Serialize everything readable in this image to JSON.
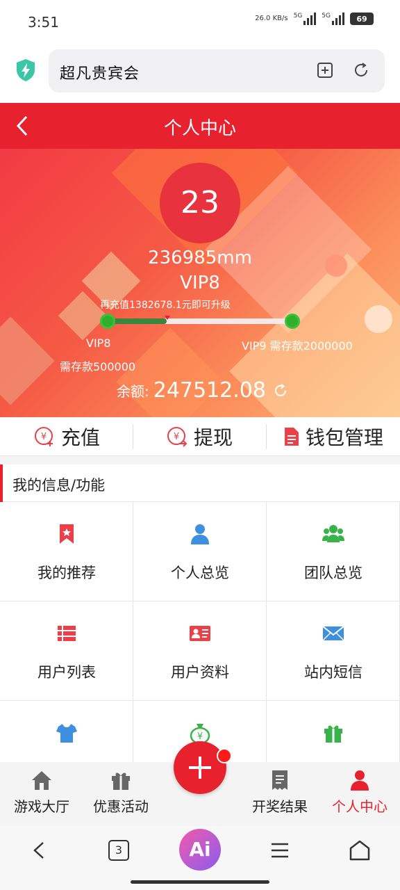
{
  "status": {
    "time": "3:51",
    "net_speed": "26.0 KB/s",
    "net1": "5G",
    "net2": "5G",
    "battery": "69"
  },
  "browser": {
    "url_title": "超凡贵宾会",
    "shield_icon": "shield-bolt-icon",
    "add_tab_icon": "add-tab-icon",
    "refresh_icon": "refresh-icon"
  },
  "header": {
    "title": "个人中心",
    "back_icon": "chevron-left-icon"
  },
  "profile": {
    "level_number": "23",
    "username": "236985mm",
    "vip": "VIP8",
    "upgrade_note": "再充值1382678.1元即可升级",
    "progress_fraction": 0.32,
    "current_level": "VIP8",
    "current_requirement": "需存款500000",
    "next_level": "VIP9 需存款2000000",
    "balance_label": "余额:",
    "balance_amount": "247512.08"
  },
  "actions": [
    {
      "label": "充值",
      "icon": "deposit-icon"
    },
    {
      "label": "提现",
      "icon": "withdraw-icon"
    },
    {
      "label": "钱包管理",
      "icon": "wallet-doc-icon"
    }
  ],
  "section": {
    "title": "我的信息/功能"
  },
  "grid": [
    {
      "label": "我的推荐",
      "icon": "bookmark-star-icon",
      "color": "#e8414a"
    },
    {
      "label": "个人总览",
      "icon": "user-icon",
      "color": "#3d8fe0"
    },
    {
      "label": "团队总览",
      "icon": "team-icon",
      "color": "#38b24a"
    },
    {
      "label": "用户列表",
      "icon": "list-icon",
      "color": "#e8414a"
    },
    {
      "label": "用户资料",
      "icon": "id-card-icon",
      "color": "#e8414a"
    },
    {
      "label": "站内短信",
      "icon": "envelope-icon",
      "color": "#3d8fe0"
    },
    {
      "label": "",
      "icon": "tshirt-icon",
      "color": "#3d8fe0"
    },
    {
      "label": "",
      "icon": "money-bag-icon",
      "color": "#38b24a"
    },
    {
      "label": "",
      "icon": "gift-icon",
      "color": "#38b24a"
    }
  ],
  "bottom_nav": [
    {
      "label": "游戏大厅",
      "icon": "home-icon"
    },
    {
      "label": "优惠活动",
      "icon": "gift-icon"
    },
    {
      "label": "开奖结果",
      "icon": "receipt-icon"
    },
    {
      "label": "个人中心",
      "icon": "person-icon",
      "active": true
    }
  ],
  "fab": {
    "icon": "plus-icon"
  },
  "system_nav": {
    "tab_count": "3",
    "ai_label": "Ai"
  },
  "colors": {
    "accent": "#e8212e",
    "green": "#2fae2f",
    "blue": "#3d8fe0"
  }
}
